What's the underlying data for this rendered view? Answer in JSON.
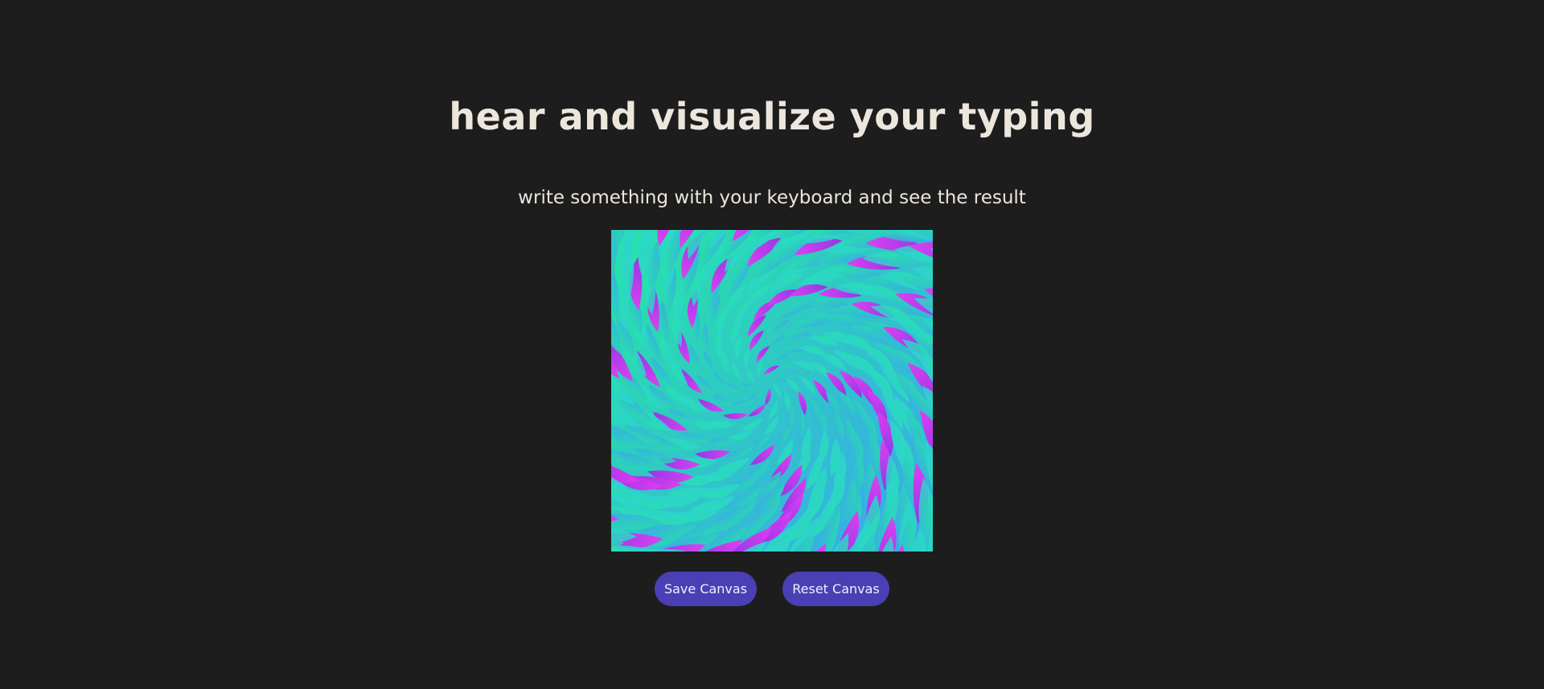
{
  "header": {
    "title": "hear and visualize your typing",
    "subtitle": "write something with your keyboard and see the result"
  },
  "canvas": {
    "palette": [
      "#25e6a2",
      "#2fd0d8",
      "#3aa6ee",
      "#c020f0",
      "#e23cf2"
    ]
  },
  "controls": {
    "save_label": "Save Canvas",
    "reset_label": "Reset Canvas"
  },
  "colors": {
    "background": "#1d1d1d",
    "text": "#ede6dd",
    "button": "#4a3fb4"
  }
}
